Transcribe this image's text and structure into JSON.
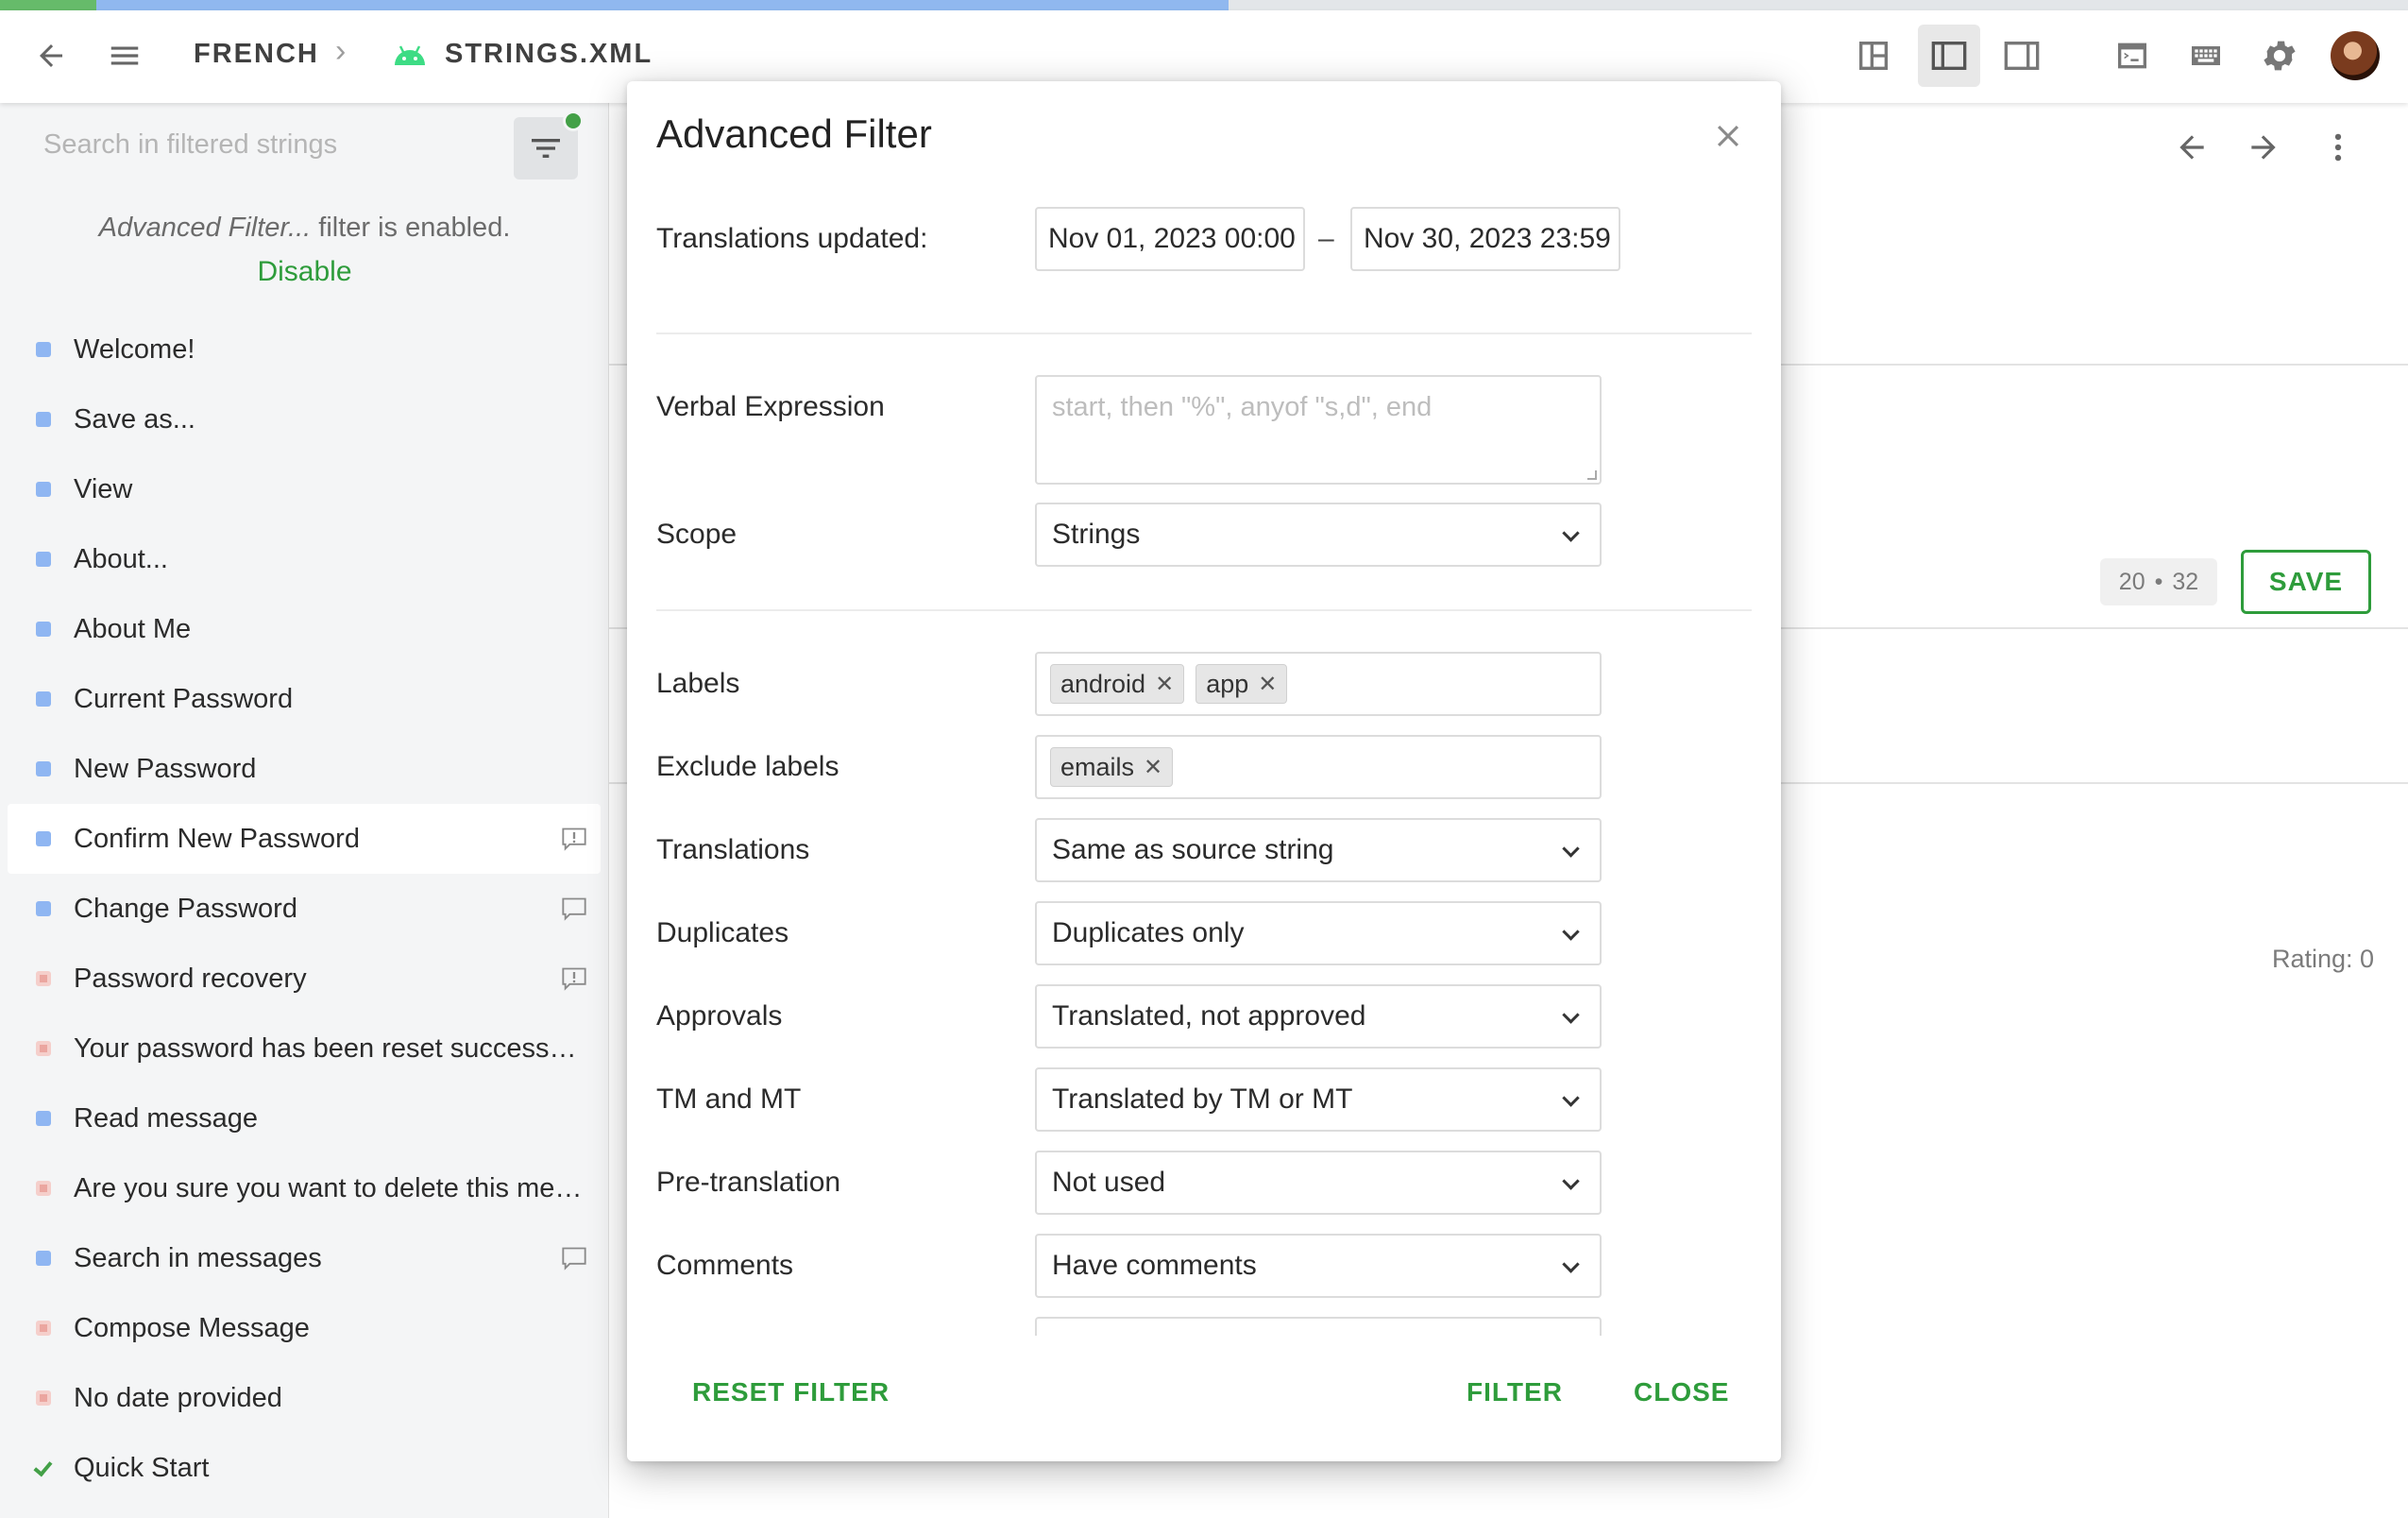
{
  "header": {
    "project": "FRENCH",
    "file": "STRINGS.XML",
    "progress_translated_percent": 4,
    "progress_approved_percent": 51
  },
  "sidebar": {
    "search_placeholder": "Search in filtered strings",
    "notice_italic": "Advanced Filter...",
    "notice_rest": " filter is enabled.",
    "disable_label": "Disable",
    "items": [
      {
        "label": "Welcome!",
        "status": "blue",
        "comment": ""
      },
      {
        "label": "Save as...",
        "status": "blue",
        "comment": ""
      },
      {
        "label": "View",
        "status": "blue",
        "comment": ""
      },
      {
        "label": "About...",
        "status": "blue",
        "comment": ""
      },
      {
        "label": "About Me",
        "status": "blue",
        "comment": ""
      },
      {
        "label": "Current Password",
        "status": "blue",
        "comment": ""
      },
      {
        "label": "New Password",
        "status": "blue",
        "comment": ""
      },
      {
        "label": "Confirm New Password",
        "status": "blue",
        "comment": "issue-icon"
      },
      {
        "label": "Change Password",
        "status": "blue",
        "comment": "comment-icon"
      },
      {
        "label": "Password recovery",
        "status": "red",
        "comment": "issue-icon"
      },
      {
        "label": "Your password has been reset successfully!",
        "status": "red",
        "comment": ""
      },
      {
        "label": "Read message",
        "status": "blue",
        "comment": ""
      },
      {
        "label": "Are you sure you want to delete this message?",
        "status": "red",
        "comment": ""
      },
      {
        "label": "Search in messages",
        "status": "blue",
        "comment": "comment-icon"
      },
      {
        "label": "Compose Message",
        "status": "red",
        "comment": ""
      },
      {
        "label": "No date provided",
        "status": "red",
        "comment": ""
      },
      {
        "label": "Quick Start",
        "status": "check",
        "comment": ""
      }
    ]
  },
  "main": {
    "counter_a": "20",
    "counter_sep": "•",
    "counter_b": "32",
    "save_label": "SAVE",
    "rating": "Rating: 0"
  },
  "dialog": {
    "title": "Advanced Filter",
    "translations_updated_label": "Translations updated:",
    "date_from": "Nov 01, 2023 00:00",
    "date_to": "Nov 30, 2023 23:59",
    "date_dash": "–",
    "verbal_label": "Verbal Expression",
    "verbal_placeholder": "start, then \"%\", anyof \"s,d\", end",
    "scope_label": "Scope",
    "scope_value": "Strings",
    "labels_label": "Labels",
    "labels": [
      "android",
      "app"
    ],
    "exclude_label": "Exclude labels",
    "exclude": [
      "emails"
    ],
    "translations_label": "Translations",
    "translations_value": "Same as source string",
    "duplicates_label": "Duplicates",
    "duplicates_value": "Duplicates only",
    "approvals_label": "Approvals",
    "approvals_value": "Translated, not approved",
    "tm_label": "TM and MT",
    "tm_value": "Translated by TM or MT",
    "pretranslation_label": "Pre-translation",
    "pretranslation_value": "Not used",
    "comments_label": "Comments",
    "comments_value": "Have comments",
    "reset_label": "RESET FILTER",
    "filter_label": "FILTER",
    "close_label": "CLOSE"
  },
  "colors": {
    "accent": "#2e9c3b",
    "progress_green": "#66bb6a",
    "progress_blue": "#90b8ef"
  }
}
